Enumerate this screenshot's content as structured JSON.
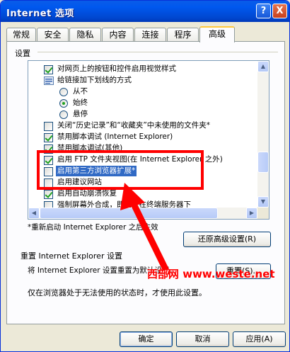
{
  "window": {
    "title": "Internet 选项",
    "help_label": "?",
    "close_label": "X"
  },
  "tabs": [
    {
      "label": "常规"
    },
    {
      "label": "安全"
    },
    {
      "label": "隐私"
    },
    {
      "label": "内容"
    },
    {
      "label": "连接"
    },
    {
      "label": "程序"
    },
    {
      "label": "高级",
      "active": true
    }
  ],
  "settings": {
    "group_label": "设置",
    "items": [
      {
        "type": "checkbox",
        "checked": true,
        "indent": 1,
        "label": "对网页上的按钮和控件启用视觉样式"
      },
      {
        "type": "group",
        "icon": "link-settings-icon",
        "indent": 1,
        "label": "给链接加下划线的方式"
      },
      {
        "type": "radio",
        "checked": false,
        "indent": 2,
        "label": "从不"
      },
      {
        "type": "radio",
        "checked": true,
        "indent": 2,
        "label": "始终"
      },
      {
        "type": "radio",
        "checked": false,
        "indent": 2,
        "label": "悬停"
      },
      {
        "type": "checkbox",
        "checked": false,
        "indent": 1,
        "label": "关闭“历史记录”和“收藏夹”中未使用的文件夹*"
      },
      {
        "type": "checkbox",
        "checked": true,
        "indent": 1,
        "label": "禁用脚本调试 (Internet Explorer)"
      },
      {
        "type": "checkbox",
        "checked": true,
        "indent": 1,
        "label": "禁用脚本调试(其他)"
      },
      {
        "type": "checkbox",
        "checked": true,
        "indent": 1,
        "label": "启用 FTP 文件夹视图(在 Internet Explorer 之外)"
      },
      {
        "type": "checkbox",
        "checked": false,
        "indent": 1,
        "label": "启用第三方浏览器扩展*",
        "selected": true
      },
      {
        "type": "checkbox",
        "checked": false,
        "indent": 1,
        "label": "启用建议网站"
      },
      {
        "type": "checkbox",
        "checked": true,
        "indent": 1,
        "label": "启用自动崩溃恢复"
      },
      {
        "type": "checkbox",
        "checked": false,
        "indent": 1,
        "label": "强制屏幕外合成，即便是在终端服务器下"
      }
    ],
    "scroll": {
      "up": "▲",
      "down": "▼",
      "left": "◀",
      "right": "▶"
    },
    "restart_note": "*重新启动 Internet Explorer 之后生效",
    "restore_button": "还原高级设置(R)"
  },
  "reset": {
    "title": "重置 Internet Explorer 设置",
    "description": "将 Internet Explorer 设置重置为默认设置。",
    "button": "重置(S)...",
    "note": "仅在浏览器处于无法使用的状态时，才使用此设置。"
  },
  "footer": {
    "ok": "确定",
    "cancel": "取消",
    "apply": "应用(A)"
  },
  "overlay": {
    "watermark": "西部网 www.weste.net"
  },
  "colors": {
    "titlebar": "#0054e3",
    "selection": "#316ac5",
    "highlight": "#ff0000"
  }
}
